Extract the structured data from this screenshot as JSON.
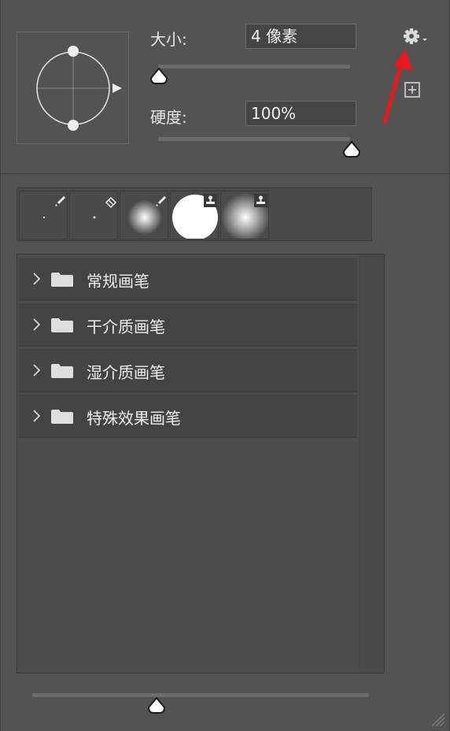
{
  "settings": {
    "size_label": "大小:",
    "size_value": "4 像素",
    "hardness_label": "硬度:",
    "hardness_value": "100%"
  },
  "recent_brushes": [
    {
      "name": "small-dot-brush",
      "tool": "brush-icon"
    },
    {
      "name": "small-dot-eraser",
      "tool": "eraser-icon"
    },
    {
      "name": "soft-round-brush",
      "tool": "brush-icon"
    },
    {
      "name": "hard-round-stamp",
      "tool": "stamp-icon"
    },
    {
      "name": "soft-round-stamp",
      "tool": "stamp-icon"
    }
  ],
  "folders": [
    {
      "label": "常规画笔"
    },
    {
      "label": "干介质画笔"
    },
    {
      "label": "湿介质画笔"
    },
    {
      "label": "特殊效果画笔"
    }
  ],
  "colors": {
    "panel_bg": "#535353",
    "row_bg": "#444444",
    "annotation_arrow": "#e8191a"
  },
  "icons": [
    "gear-icon",
    "new-preset-icon",
    "chevron-right-icon",
    "folder-icon",
    "resize-grip-icon"
  ]
}
